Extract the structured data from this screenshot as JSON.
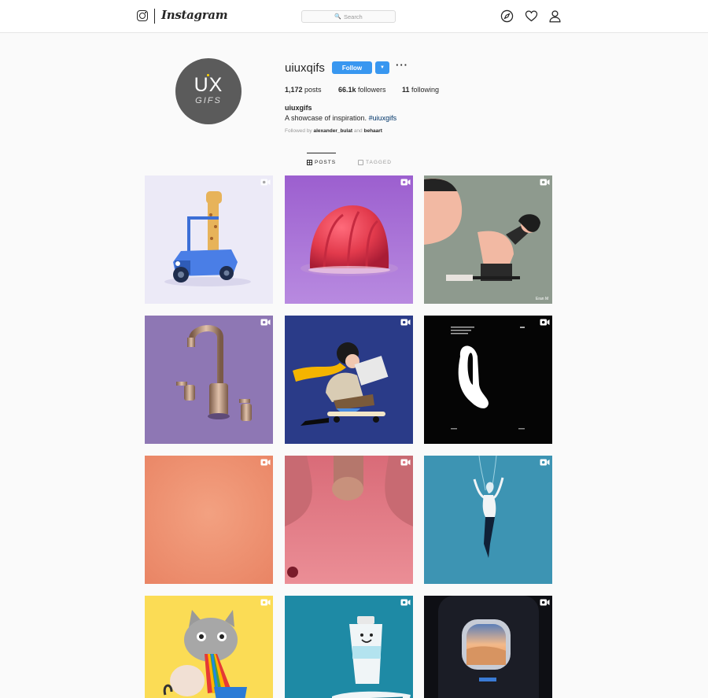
{
  "nav": {
    "logo_icon": "instagram-camera-icon",
    "wordmark": "Instagram",
    "search_placeholder": "Search",
    "icons": [
      "compass-icon",
      "heart-icon",
      "person-icon"
    ]
  },
  "profile": {
    "avatar": {
      "line1": "UX",
      "line2": "GIFS"
    },
    "username": "uiuxqifs",
    "follow_label": "Follow",
    "dropdown_icon": "caret-down-icon",
    "more_icon": "more-dots-icon",
    "stats": {
      "posts_count": "1,172",
      "posts_label": "posts",
      "followers_count": "66.1k",
      "followers_label": "followers",
      "following_count": "11",
      "following_label": "following"
    },
    "full_name": "uiuxgifs",
    "bio_text": "A showcase of inspiration.",
    "bio_hashtag": "#uiuxgifs",
    "followed_by_prefix": "Followed by",
    "followed_by_user1": "alexander_bulat",
    "followed_by_and": "and",
    "followed_by_user2": "behaart"
  },
  "tabs": [
    {
      "label": "POSTS",
      "icon": "grid-icon",
      "active": true
    },
    {
      "label": "TAGGED",
      "icon": "tag-icon",
      "active": false
    }
  ],
  "grid": {
    "video_icon": "video-camera-icon",
    "posts": [
      {
        "subject": "giraffe-car",
        "bg": "#eceaf7",
        "video": true
      },
      {
        "subject": "red-blob",
        "bg": "#a86ed3",
        "video": true
      },
      {
        "subject": "man-on-bottle",
        "bg": "#8e9a8e",
        "video": true,
        "caption": "Eran M"
      },
      {
        "subject": "faucet",
        "bg": "#8e77b4",
        "video": true
      },
      {
        "subject": "skateboard-girl",
        "bg": "#2a3b88",
        "video": true
      },
      {
        "subject": "black-poster",
        "bg": "#050505",
        "video": true
      },
      {
        "subject": "orange-gradient",
        "bg": "#ee8c6c",
        "video": true
      },
      {
        "subject": "pink-fabric",
        "bg": "#e07a86",
        "video": true
      },
      {
        "subject": "diver-woman",
        "bg": "#3d94b3",
        "video": true
      },
      {
        "subject": "rainbow-cat",
        "bg": "#fbdc55",
        "video": true
      },
      {
        "subject": "toothpaste",
        "bg": "#1e8aa5",
        "video": true
      },
      {
        "subject": "airplane-window",
        "bg": "#0e0f14",
        "video": true
      }
    ]
  }
}
